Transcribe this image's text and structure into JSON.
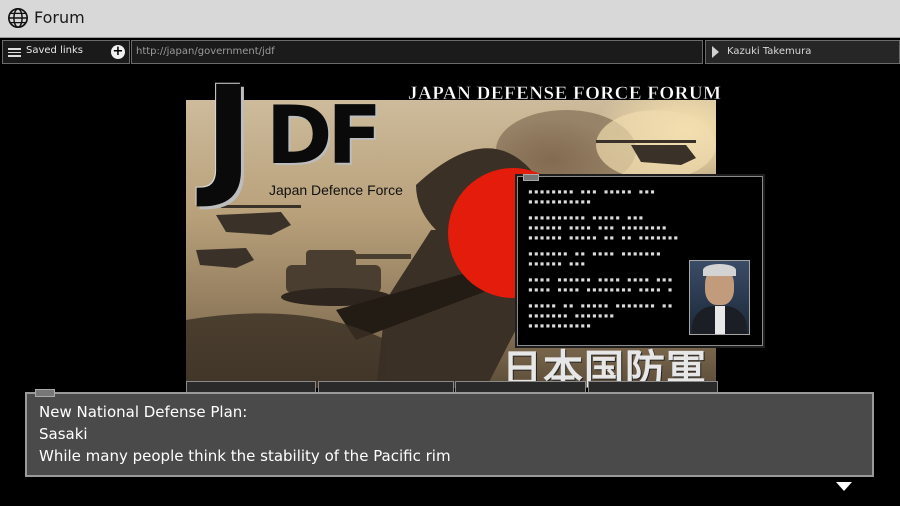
{
  "window": {
    "title": "Forum",
    "icon": "globe-icon"
  },
  "nav": {
    "saved_links_label": "Saved links",
    "url": "http://japan/government/jdf",
    "user_name": "Kazuki Takemura"
  },
  "banner": {
    "logo_text_j": "J",
    "logo_text_df": "DF",
    "logo_subtitle": "Japan Defence Force",
    "forum_title": "JAPAN DEFENSE FORCE FORUM",
    "kanji": "日本国防軍"
  },
  "dialog": {
    "heading": "New National Defense Plan:",
    "speaker": "Sasaki",
    "text": "While many people think the stability of the Pacific rim"
  },
  "colors": {
    "accent_red": "#e31c0c",
    "dialog_bg": "#4a4a4a"
  }
}
